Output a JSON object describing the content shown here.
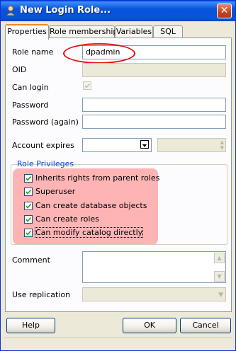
{
  "window": {
    "title": "New Login Role...",
    "close_label": "✕"
  },
  "tabs": [
    {
      "label": "Properties",
      "active": true
    },
    {
      "label": "Role membership",
      "active": false
    },
    {
      "label": "Variables",
      "active": false
    },
    {
      "label": "SQL",
      "active": false
    }
  ],
  "form": {
    "role_name_label": "Role name",
    "role_name_value": "dpadmin",
    "oid_label": "OID",
    "oid_value": "",
    "can_login_label": "Can login",
    "can_login_checked": true,
    "password_label": "Password",
    "password_value": "",
    "password_again_label": "Password (again)",
    "password_again_value": "",
    "account_expires_label": "Account expires",
    "account_expires_date": "",
    "account_expires_time": "",
    "comment_label": "Comment",
    "comment_value": "",
    "use_replication_label": "Use replication",
    "use_replication_value": ""
  },
  "privileges": {
    "group_title": "Role Privileges",
    "items": [
      {
        "label": "Inherits rights from parent roles",
        "checked": true
      },
      {
        "label": "Superuser",
        "checked": true
      },
      {
        "label": "Can create database objects",
        "checked": true
      },
      {
        "label": "Can create roles",
        "checked": true
      },
      {
        "label": "Can modify catalog directly",
        "checked": true
      }
    ]
  },
  "buttons": {
    "help": "Help",
    "ok": "OK",
    "cancel": "Cancel"
  },
  "colors": {
    "titlebar": "#0855dd",
    "highlight": "#ff7878",
    "annotation_oval": "#e01010",
    "group_title": "#0046d5"
  }
}
